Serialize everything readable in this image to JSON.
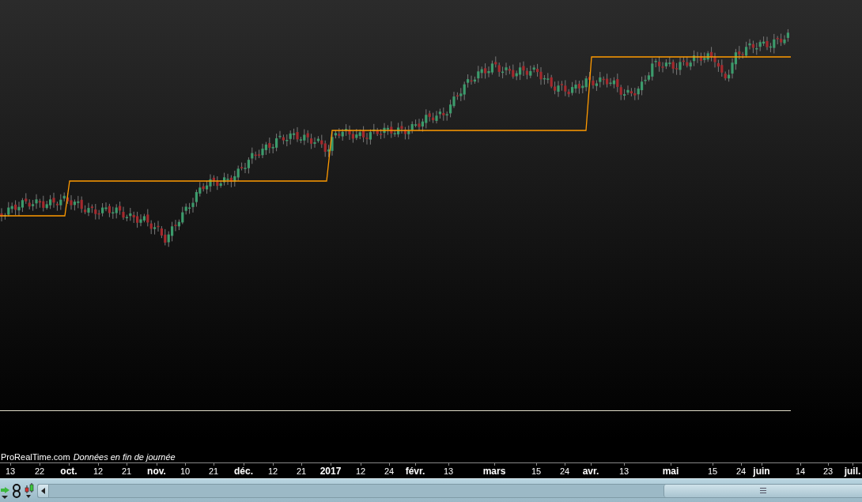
{
  "chart": {
    "source": "ProRealTime.com",
    "data_note": "Données en fin de journée"
  },
  "time_axis": [
    {
      "label": "13",
      "major": false
    },
    {
      "label": "22",
      "major": false
    },
    {
      "label": "oct.",
      "major": true
    },
    {
      "label": "12",
      "major": false
    },
    {
      "label": "21",
      "major": false
    },
    {
      "label": "nov.",
      "major": true
    },
    {
      "label": "10",
      "major": false
    },
    {
      "label": "21",
      "major": false
    },
    {
      "label": "déc.",
      "major": true
    },
    {
      "label": "12",
      "major": false
    },
    {
      "label": "21",
      "major": false
    },
    {
      "label": "2017",
      "major": true
    },
    {
      "label": "12",
      "major": false
    },
    {
      "label": "24",
      "major": false
    },
    {
      "label": "févr.",
      "major": true
    },
    {
      "label": "13",
      "major": false
    },
    {
      "label": "mars",
      "major": true
    },
    {
      "label": "15",
      "major": false
    },
    {
      "label": "24",
      "major": false
    },
    {
      "label": "avr.",
      "major": true
    },
    {
      "label": "13",
      "major": false
    },
    {
      "label": "mai",
      "major": true
    },
    {
      "label": "15",
      "major": false
    },
    {
      "label": "24",
      "major": false
    },
    {
      "label": "juin",
      "major": true
    },
    {
      "label": "14",
      "major": false
    },
    {
      "label": "23",
      "major": false
    },
    {
      "label": "juil.",
      "major": true
    }
  ]
}
